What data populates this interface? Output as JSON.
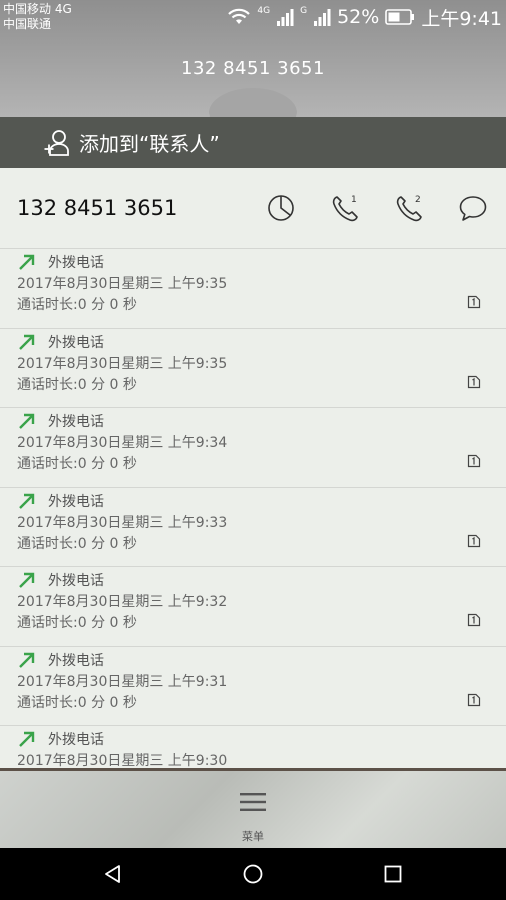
{
  "status_bar": {
    "carrier_1": "中国移动 4G",
    "carrier_2": "中国联通",
    "sim1_net": "4G",
    "sim2_net": "G",
    "battery": "52%",
    "time": "上午9:41"
  },
  "header": {
    "number": "132 8451 3651"
  },
  "add_contact": {
    "label": "添加到“联系人”"
  },
  "detail": {
    "number": "132 8451 3651",
    "sim1_label": "1",
    "sim2_label": "2"
  },
  "calls": [
    {
      "type": "外拨电话",
      "date": "2017年8月30日星期三 上午9:35",
      "duration": "通话时长:0 分 0 秒"
    },
    {
      "type": "外拨电话",
      "date": "2017年8月30日星期三 上午9:35",
      "duration": "通话时长:0 分 0 秒"
    },
    {
      "type": "外拨电话",
      "date": "2017年8月30日星期三 上午9:34",
      "duration": "通话时长:0 分 0 秒"
    },
    {
      "type": "外拨电话",
      "date": "2017年8月30日星期三 上午9:33",
      "duration": "通话时长:0 分 0 秒"
    },
    {
      "type": "外拨电话",
      "date": "2017年8月30日星期三 上午9:32",
      "duration": "通话时长:0 分 0 秒"
    },
    {
      "type": "外拨电话",
      "date": "2017年8月30日星期三 上午9:31",
      "duration": "通话时长:0 分 0 秒"
    },
    {
      "type": "外拨电话",
      "date": "2017年8月30日星期三 上午9:30",
      "duration": ""
    }
  ],
  "menu": {
    "label": "菜单"
  },
  "colors": {
    "outgoing_arrow": "#3aa34a",
    "add_contact_bar": "#545752",
    "list_background": "#ecefea"
  },
  "icons": {
    "status": [
      "wifi-icon",
      "signal-icon",
      "battery-icon"
    ],
    "actions": [
      "chart-icon",
      "call-sim1-icon",
      "call-sim2-icon",
      "message-icon"
    ],
    "nav": [
      "back-icon",
      "home-icon",
      "recents-icon"
    ]
  }
}
